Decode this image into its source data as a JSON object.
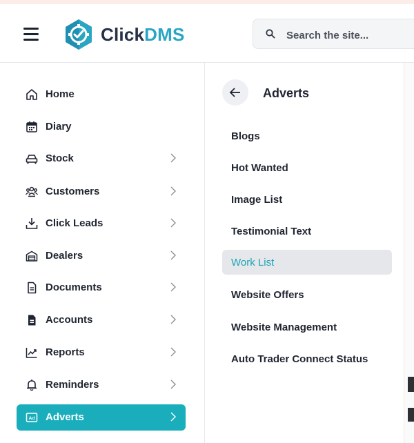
{
  "header": {
    "menu_icon": "hamburger-icon",
    "logo_icon": "click-dms-logo-icon",
    "logo_text_part1": "Click",
    "logo_text_part2": "DMS",
    "search_placeholder": "Search the site...",
    "search_icon": "search-icon"
  },
  "colors": {
    "accent": "#1aaebd",
    "brand_dark": "#263145",
    "brand_light": "#2aa6c3",
    "selected_text": "#1aa3b8"
  },
  "sidebar": {
    "items": [
      {
        "label": "Home",
        "icon": "home-icon",
        "has_chevron": false
      },
      {
        "label": "Diary",
        "icon": "calendar-icon",
        "has_chevron": false
      },
      {
        "label": "Stock",
        "icon": "car-icon",
        "has_chevron": true
      },
      {
        "label": "Customers",
        "icon": "users-icon",
        "has_chevron": true
      },
      {
        "label": "Click Leads",
        "icon": "download-tray-icon",
        "has_chevron": true
      },
      {
        "label": "Dealers",
        "icon": "garage-icon",
        "has_chevron": true
      },
      {
        "label": "Documents",
        "icon": "document-icon",
        "has_chevron": true
      },
      {
        "label": "Accounts",
        "icon": "accounts-file-icon",
        "has_chevron": true
      },
      {
        "label": "Reports",
        "icon": "chart-line-icon",
        "has_chevron": true
      },
      {
        "label": "Reminders",
        "icon": "bell-icon",
        "has_chevron": true
      },
      {
        "label": "Adverts",
        "icon": "ad-icon",
        "has_chevron": true,
        "active": true
      }
    ]
  },
  "subpanel": {
    "title": "Adverts",
    "back_icon": "arrow-left-icon",
    "items": [
      {
        "label": "Blogs"
      },
      {
        "label": "Hot Wanted"
      },
      {
        "label": "Image List"
      },
      {
        "label": "Testimonial Text"
      },
      {
        "label": "Work List",
        "selected": true
      },
      {
        "label": "Website Offers"
      },
      {
        "label": "Website Management"
      },
      {
        "label": "Auto Trader Connect Status"
      }
    ]
  }
}
